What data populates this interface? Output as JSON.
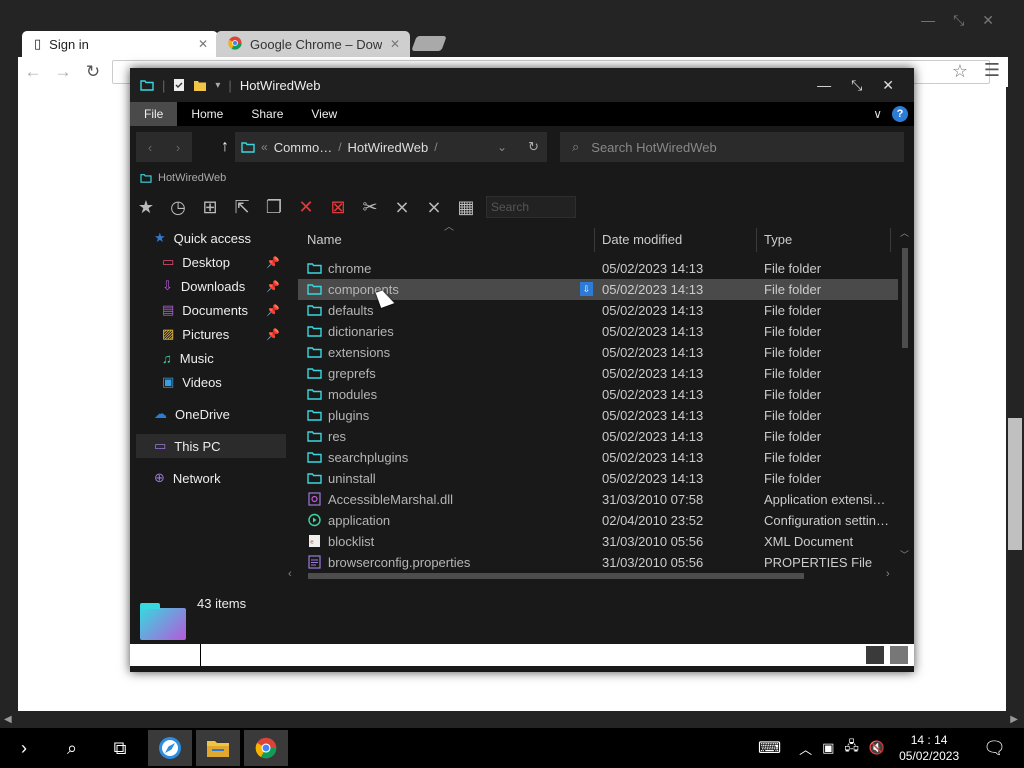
{
  "browser": {
    "tabs": [
      {
        "title": "Sign in",
        "active": true
      },
      {
        "title": "Google Chrome – Downl",
        "active": false
      }
    ],
    "window_controls": {
      "min": "—",
      "max": "⤡",
      "close": "✕"
    }
  },
  "explorer": {
    "title": "HotWiredWeb",
    "ribbon_tabs": [
      "File",
      "Home",
      "Share",
      "View"
    ],
    "help_label": "?",
    "breadcrumb": {
      "prefix": "«",
      "part1": "Commo…",
      "sep": "/",
      "part2": "HotWiredWeb",
      "sep2": "/"
    },
    "search_placeholder": "Search HotWiredWeb",
    "path_label": "HotWiredWeb",
    "toolbar_search_placeholder": "Search",
    "nav": {
      "quick_access": "Quick access",
      "desktop": "Desktop",
      "downloads": "Downloads",
      "documents": "Documents",
      "pictures": "Pictures",
      "music": "Music",
      "videos": "Videos",
      "onedrive": "OneDrive",
      "this_pc": "This PC",
      "network": "Network"
    },
    "columns": {
      "name": "Name",
      "date": "Date modified",
      "type": "Type"
    },
    "files": [
      {
        "name": "chrome",
        "date": "05/02/2023 14:13",
        "type": "File folder",
        "kind": "folder"
      },
      {
        "name": "components",
        "date": "05/02/2023 14:13",
        "type": "File folder",
        "kind": "folder",
        "selected": true
      },
      {
        "name": "defaults",
        "date": "05/02/2023 14:13",
        "type": "File folder",
        "kind": "folder"
      },
      {
        "name": "dictionaries",
        "date": "05/02/2023 14:13",
        "type": "File folder",
        "kind": "folder"
      },
      {
        "name": "extensions",
        "date": "05/02/2023 14:13",
        "type": "File folder",
        "kind": "folder"
      },
      {
        "name": "greprefs",
        "date": "05/02/2023 14:13",
        "type": "File folder",
        "kind": "folder"
      },
      {
        "name": "modules",
        "date": "05/02/2023 14:13",
        "type": "File folder",
        "kind": "folder"
      },
      {
        "name": "plugins",
        "date": "05/02/2023 14:13",
        "type": "File folder",
        "kind": "folder"
      },
      {
        "name": "res",
        "date": "05/02/2023 14:13",
        "type": "File folder",
        "kind": "folder"
      },
      {
        "name": "searchplugins",
        "date": "05/02/2023 14:13",
        "type": "File folder",
        "kind": "folder"
      },
      {
        "name": "uninstall",
        "date": "05/02/2023 14:13",
        "type": "File folder",
        "kind": "folder"
      },
      {
        "name": "AccessibleMarshal.dll",
        "date": "31/03/2010 07:58",
        "type": "Application extensi…",
        "kind": "dll"
      },
      {
        "name": "application",
        "date": "02/04/2010 23:52",
        "type": "Configuration settin…",
        "kind": "config"
      },
      {
        "name": "blocklist",
        "date": "31/03/2010 05:56",
        "type": "XML Document",
        "kind": "xml"
      },
      {
        "name": "browserconfig.properties",
        "date": "31/03/2010 05:56",
        "type": "PROPERTIES File",
        "kind": "properties"
      }
    ],
    "item_count": "43 items"
  },
  "taskbar": {
    "time": "14 : 14",
    "date": "05/02/2023"
  },
  "colors": {
    "folder": "#38d8e0",
    "accent": "#2c7bd6",
    "delete": "#e23a3a"
  }
}
